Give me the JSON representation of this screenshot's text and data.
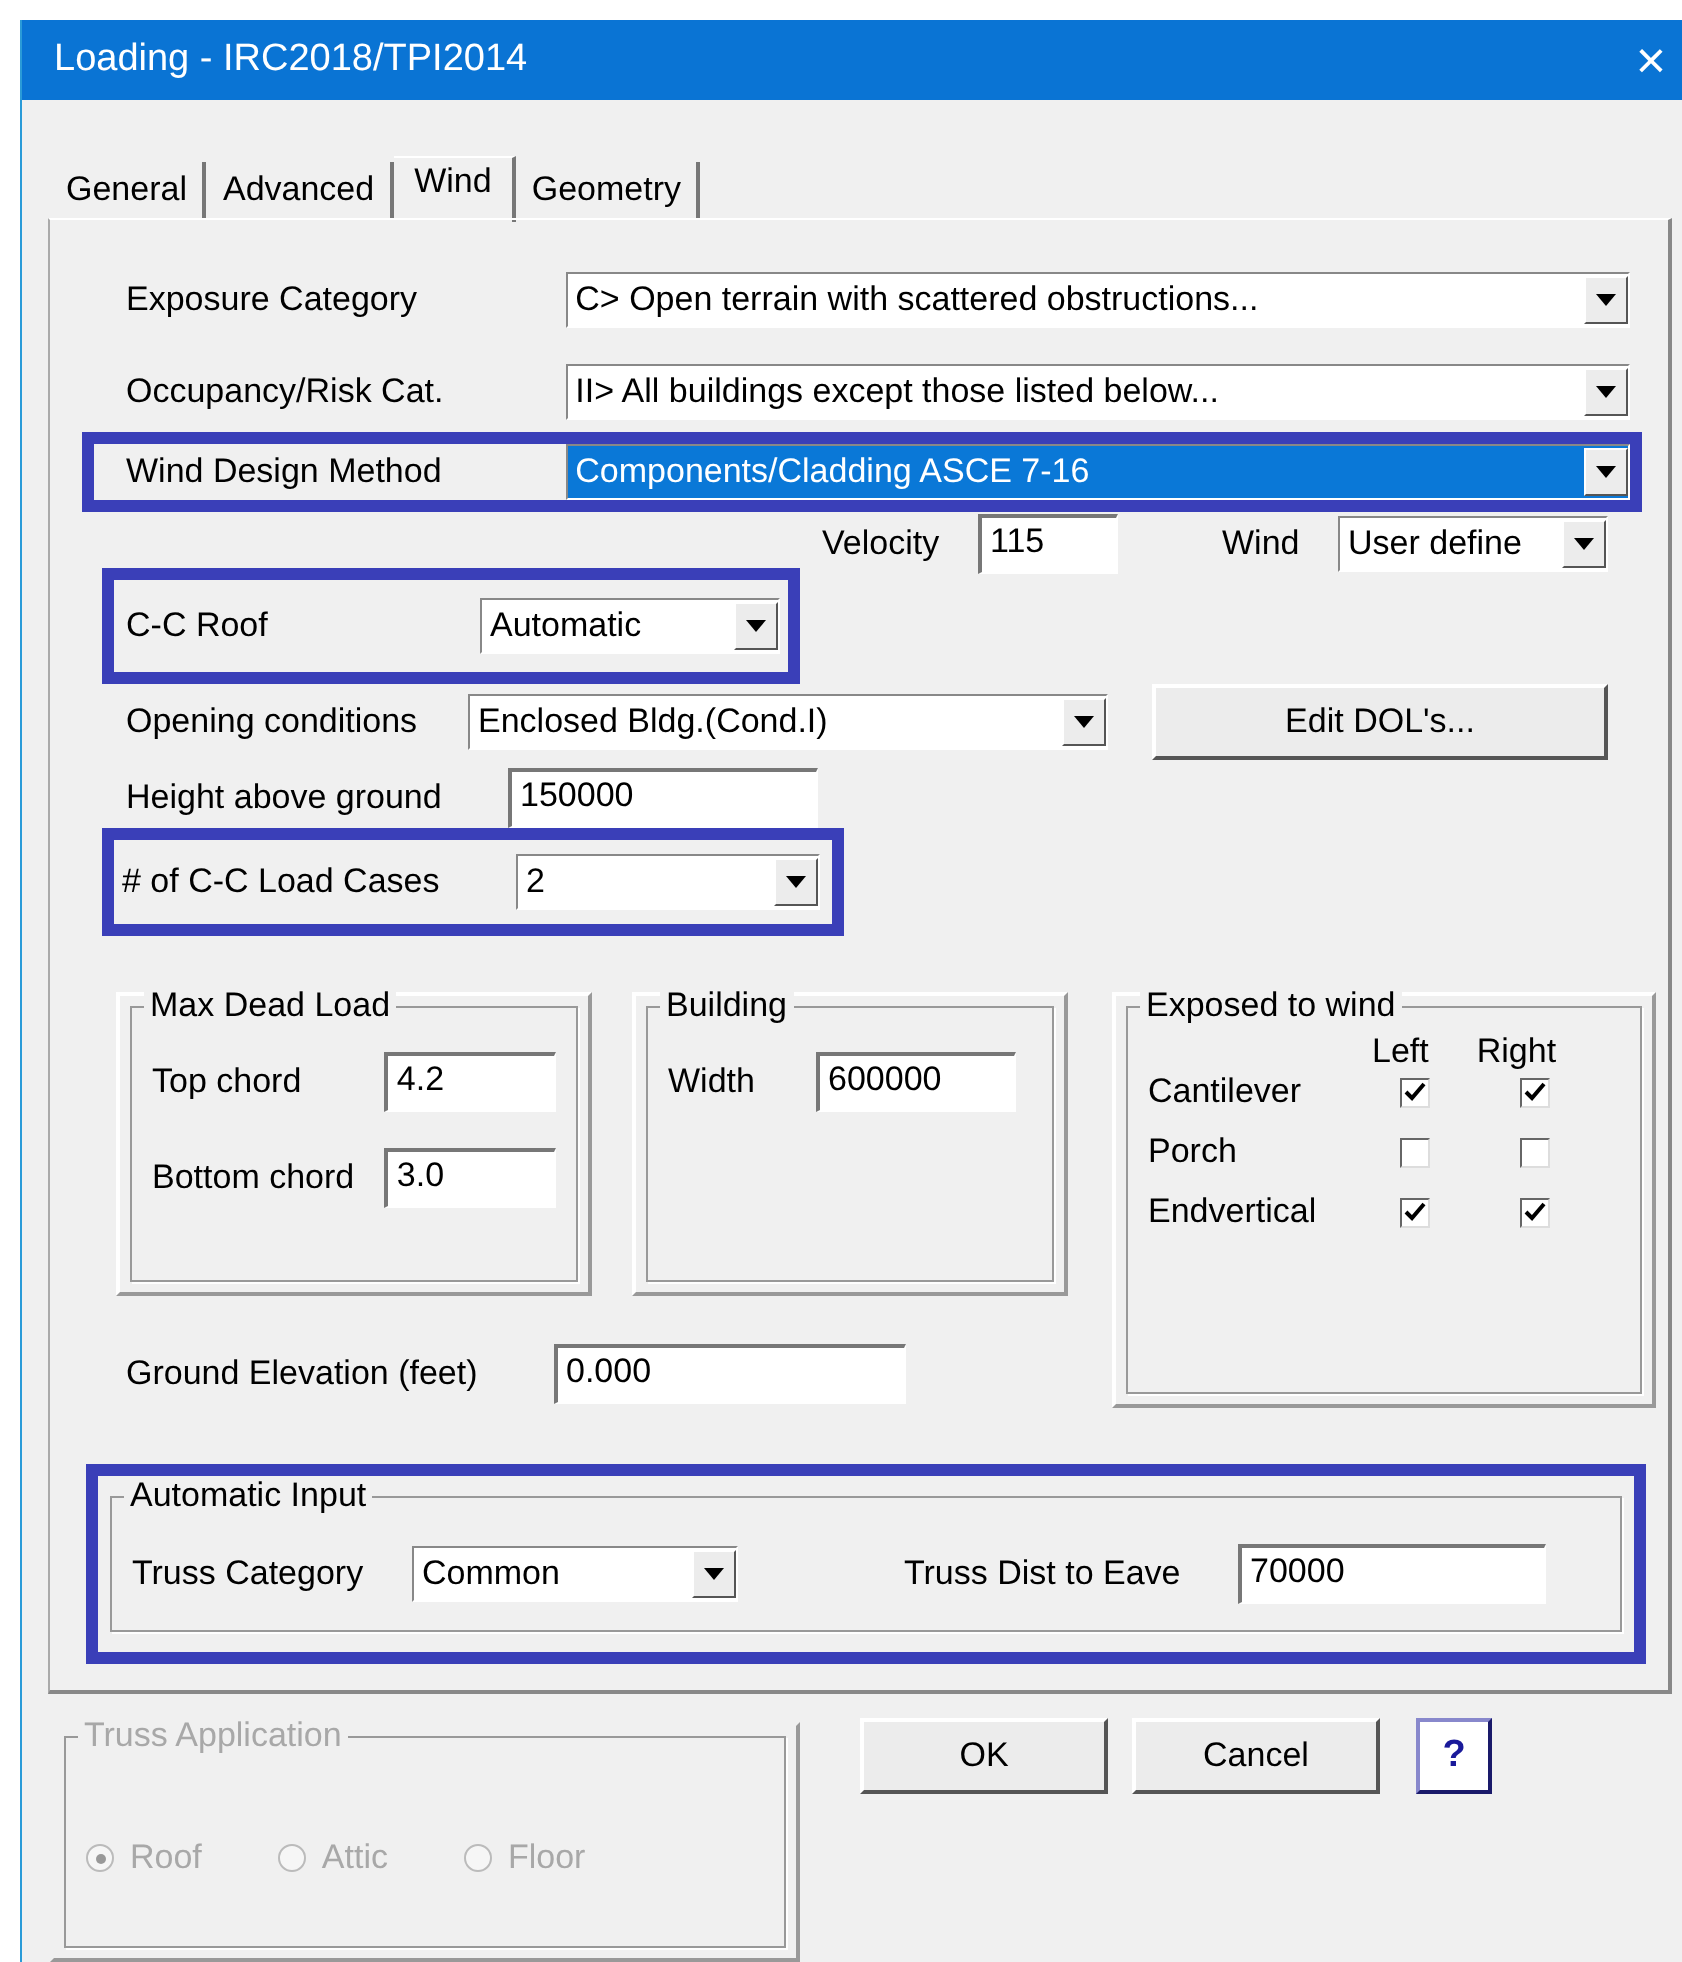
{
  "window": {
    "title": "Loading - IRC2018/TPI2014",
    "close": "×"
  },
  "tabs": [
    {
      "label": "General",
      "selected": false
    },
    {
      "label": "Advanced",
      "selected": false
    },
    {
      "label": "Wind",
      "selected": true
    },
    {
      "label": "Geometry",
      "selected": false
    }
  ],
  "selects": [
    {
      "label": "Exposure Category",
      "value": "C> Open terrain with scattered obstructions...",
      "highlighted": false,
      "focused": false
    },
    {
      "label": "Occupancy/Risk Cat.",
      "value": "II> All buildings except those listed below...",
      "highlighted": false,
      "focused": false
    },
    {
      "label": "Wind Design Method",
      "value": "Components/Cladding ASCE 7-16",
      "highlighted": true,
      "focused": true
    }
  ],
  "velocity": {
    "label": "Velocity",
    "value": "115"
  },
  "wind": {
    "label": "Wind",
    "value": "User define"
  },
  "cc_roof": {
    "label": "C-C Roof",
    "value": "Automatic",
    "highlighted": true
  },
  "opening": {
    "label": "Opening conditions",
    "value": "Enclosed Bldg.(Cond.I)"
  },
  "edit_button": "Edit DOL's...",
  "height": {
    "label": "Height above ground",
    "value": "150000"
  },
  "load_cases": {
    "label": "# of C-C Load Cases",
    "value": "2",
    "highlighted": true
  },
  "max_dead_load": {
    "title": "Max Dead Load",
    "fields": [
      {
        "label": "Top chord",
        "value": "4.2"
      },
      {
        "label": "Bottom chord",
        "value": "3.0"
      }
    ]
  },
  "building": {
    "title": "Building",
    "fields": [
      {
        "label": "Width",
        "value": "600000"
      }
    ]
  },
  "exposed": {
    "title": "Exposed to wind",
    "columns": [
      "Left",
      "Right"
    ],
    "rows": [
      {
        "label": "Cantilever",
        "left": true,
        "right": true
      },
      {
        "label": "Porch",
        "left": false,
        "right": false
      },
      {
        "label": "Endvertical",
        "left": true,
        "right": true
      }
    ]
  },
  "ground_elevation": {
    "label": "Ground Elevation (feet)",
    "value": "0.000"
  },
  "automatic_input": {
    "title": "Automatic Input",
    "highlighted": true,
    "truss_category": {
      "label": "Truss Category",
      "value": "Common"
    },
    "truss_dist": {
      "label": "Truss Dist to Eave",
      "value": "70000"
    }
  },
  "truss_application": {
    "title": "Truss Application",
    "disabled": true,
    "options": [
      {
        "label": "Roof",
        "selected": true
      },
      {
        "label": "Attic",
        "selected": false
      },
      {
        "label": "Floor",
        "selected": false
      }
    ]
  },
  "buttons": [
    "OK",
    "Cancel"
  ],
  "help": "?"
}
